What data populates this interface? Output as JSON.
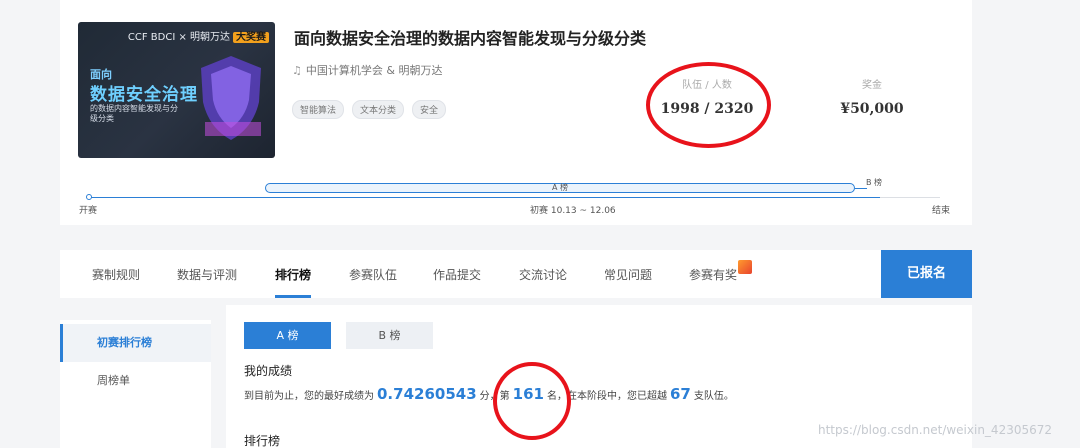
{
  "banner": {
    "brand": "CCF BDCI × 明朝万达",
    "brand_badge": "大奖赛",
    "line1": "面向",
    "line2": "数据安全治理",
    "line3": "的数据内容智能发现与分级分类"
  },
  "competition": {
    "title": "面向数据安全治理的数据内容智能发现与分级分类",
    "org": "中国计算机学会 & 明朝万达",
    "tags": [
      "智能算法",
      "文本分类",
      "安全"
    ],
    "teams_label": "队伍 / 人数",
    "teams_value": "1998 / 2320",
    "prize_label": "奖金",
    "prize_value": "¥50,000"
  },
  "timeline": {
    "start": "开赛",
    "phase_a": "A 榜",
    "phase_b": "B 榜",
    "prelim": "初赛 10.13 ~ 12.06",
    "end": "结束"
  },
  "nav": {
    "tabs": [
      "赛制规则",
      "数据与评测",
      "排行榜",
      "参赛队伍",
      "作品提交",
      "交流讨论",
      "常见问题",
      "参赛有奖"
    ],
    "active_tab": "排行榜",
    "registered": "已报名"
  },
  "sidebar": {
    "items": [
      "初赛排行榜",
      "周榜单"
    ],
    "active": "初赛排行榜"
  },
  "leaderboard": {
    "tab_a": "A 榜",
    "tab_b": "B 榜",
    "my_score_title": "我的成绩",
    "text1": "到目前为止，您的最好成绩为",
    "best_score": "0.74260543",
    "text2": "分，第",
    "rank": "161",
    "text3": "名，在本阶段中，您已超越",
    "beaten": "67",
    "text4": "支队伍。",
    "list_title": "排行榜"
  },
  "watermark": "https://blog.csdn.net/weixin_42305672",
  "colors": {
    "accent": "#2b7fd6",
    "annotation": "#e8131b"
  }
}
